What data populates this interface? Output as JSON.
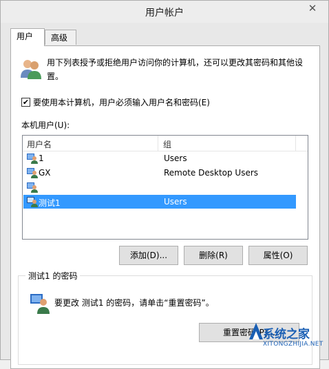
{
  "window": {
    "title": "用户帐户",
    "close_glyph": "✕"
  },
  "tabs": [
    {
      "label": "用户",
      "active": true
    },
    {
      "label": "高级",
      "active": false
    }
  ],
  "users_tab": {
    "description": "用下列表授予或拒绝用户访问你的计算机，还可以更改其密码和其他设置。",
    "require_password_label": "要使用本计算机，用户必须输入用户名和密码(E)",
    "require_password_checked": true,
    "check_glyph": "✔",
    "local_users_label": "本机用户(U):",
    "columns": [
      "用户名",
      "组"
    ],
    "rows": [
      {
        "name": "1",
        "group": "Users",
        "selected": false
      },
      {
        "name": "GX",
        "group": "Remote Desktop Users",
        "selected": false
      },
      {
        "name": "",
        "group": "",
        "selected": false
      },
      {
        "name": "测试1",
        "group": "Users",
        "selected": true
      }
    ],
    "buttons": {
      "add": "添加(D)...",
      "delete": "删除(R)",
      "properties": "属性(O)"
    },
    "password_group": {
      "title": "测试1 的密码",
      "text": "要更改 测试1 的密码，请单击“重置密码”。",
      "reset_button": "重置密码(P)..."
    }
  },
  "watermark": {
    "text": "系统之家",
    "url": "XITONGZHIJIA.NET"
  },
  "colors": {
    "selection": "#3399ff",
    "accent": "#1a5fb4"
  }
}
